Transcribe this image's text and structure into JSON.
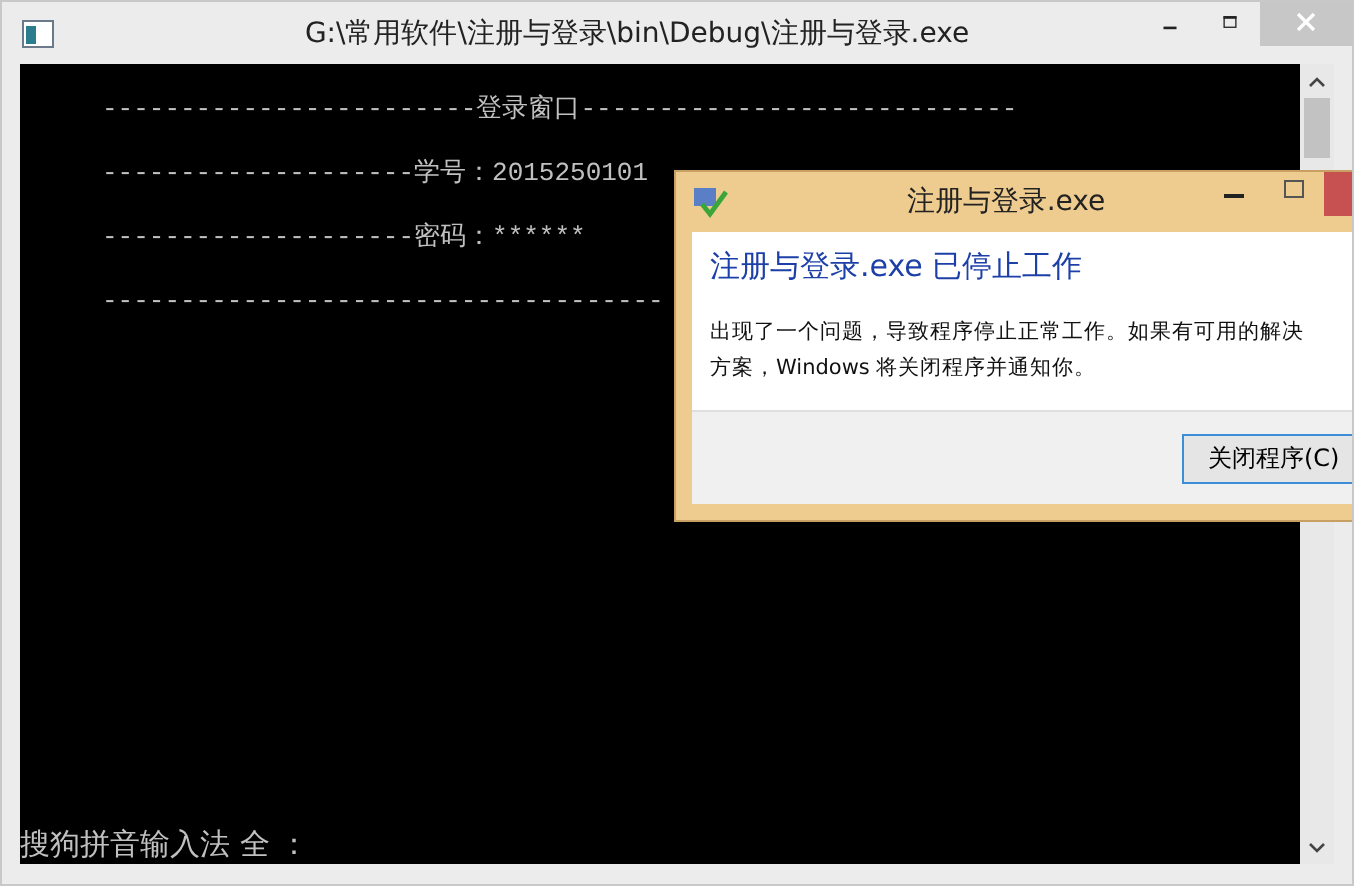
{
  "window": {
    "title": "G:\\常用软件\\注册与登录\\bin\\Debug\\注册与登录.exe"
  },
  "console": {
    "lines": [
      {
        "text": "------------------------登录窗口----------------------------"
      },
      {
        "text": "--------------------学号：2015250101"
      },
      {
        "text": "--------------------密码：******"
      },
      {
        "text": "------------------------------------"
      }
    ],
    "status": "搜狗拼音输入法 全 ："
  },
  "dialog": {
    "title": "注册与登录.exe",
    "heading": "注册与登录.exe 已停止工作",
    "message": "出现了一个问题，导致程序停止正常工作。如果有可用的解决",
    "message_2": "方案，Windows 将关闭程序并通知你。",
    "button": "关闭程序(C)"
  }
}
